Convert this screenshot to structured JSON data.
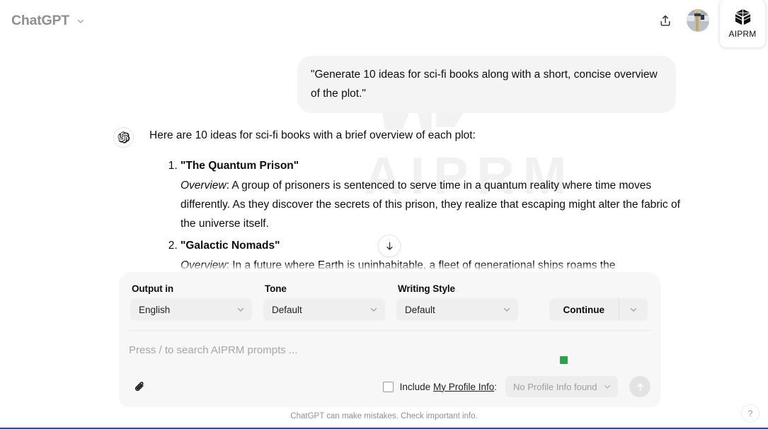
{
  "header": {
    "brand": "ChatGPT",
    "brand_caret_icon": "chevron-down-icon",
    "share_icon": "share-upload-icon",
    "avatar_icon": "user-avatar",
    "aiprm_button_label": "AIPRM",
    "aiprm_logo_icon": "aiprm-cube-icon"
  },
  "watermark": {
    "text": "AIPRM"
  },
  "conversation": {
    "user_message": "\"Generate 10 ideas for sci-fi books along with a short, concise overview of the plot.\"",
    "assistant_avatar_icon": "openai-logo-icon",
    "assistant_intro": "Here are 10 ideas for sci-fi books with a brief overview of each plot:",
    "ideas": [
      {
        "number": "1.",
        "title": "\"The Quantum Prison\"",
        "overview_label": "Overview",
        "overview": ": A group of prisoners is sentenced to serve time in a quantum reality where time moves differently. As they discover the secrets of this prison, they realize that escaping might alter the fabric of the universe itself."
      },
      {
        "number": "2.",
        "title": "\"Galactic Nomads\"",
        "overview_label": "Overview",
        "overview": ": In a future where Earth is uninhabitable, a fleet of generational ships roams the"
      }
    ],
    "scroll_down_icon": "arrow-down-icon"
  },
  "composer": {
    "fields": [
      {
        "label": "Output in",
        "value": "English",
        "caret_icon": "chevron-down-icon"
      },
      {
        "label": "Tone",
        "value": "Default",
        "caret_icon": "chevron-down-icon"
      },
      {
        "label": "Writing Style",
        "value": "Default",
        "caret_icon": "chevron-down-icon"
      }
    ],
    "continue_label": "Continue",
    "continue_caret_icon": "chevron-down-icon",
    "prompt_placeholder": "Press / to search AIPRM prompts ...",
    "status_dot_color": "#2ba24c",
    "attach_icon": "paperclip-icon",
    "include_profile_prefix": "Include ",
    "include_profile_link": "My Profile Info",
    "include_profile_suffix": ":",
    "profile_select_value": "No Profile Info found",
    "profile_select_caret_icon": "chevron-down-icon",
    "send_icon": "arrow-up-icon"
  },
  "footer": {
    "disclaimer": "ChatGPT can make mistakes. Check important info.",
    "help_label": "?"
  }
}
